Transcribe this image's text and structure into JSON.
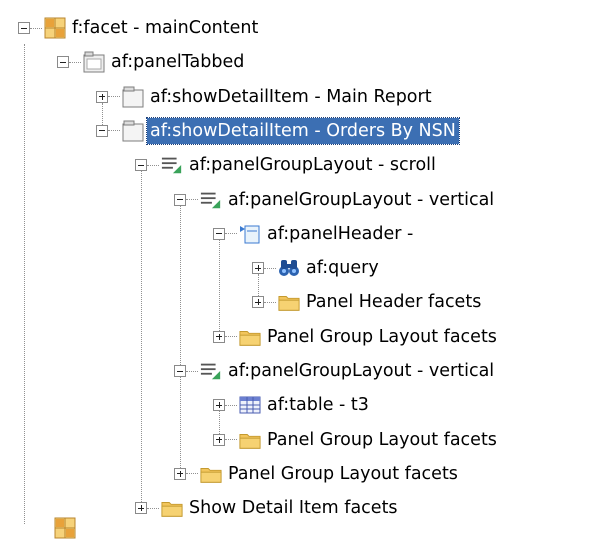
{
  "tree": {
    "nodes": [
      {
        "label": "f:facet - mainContent",
        "icon": "facet-icon",
        "depth": 0,
        "state": "expanded",
        "selected": false
      },
      {
        "label": "af:panelTabbed",
        "icon": "panel-tabbed-icon",
        "depth": 1,
        "state": "expanded",
        "selected": false
      },
      {
        "label": "af:showDetailItem - Main Report",
        "icon": "show-detail-item-icon",
        "depth": 2,
        "state": "collapsed",
        "selected": false
      },
      {
        "label": "af:showDetailItem - Orders By NSN",
        "icon": "show-detail-item-icon",
        "depth": 2,
        "state": "expanded",
        "selected": true
      },
      {
        "label": "af:panelGroupLayout - scroll",
        "icon": "panel-group-layout-icon",
        "depth": 3,
        "state": "expanded",
        "selected": false
      },
      {
        "label": "af:panelGroupLayout - vertical",
        "icon": "panel-group-layout-icon",
        "depth": 4,
        "state": "expanded",
        "selected": false
      },
      {
        "label": "af:panelHeader -",
        "icon": "panel-header-icon",
        "depth": 5,
        "state": "expanded",
        "selected": false
      },
      {
        "label": "af:query",
        "icon": "binoculars-icon",
        "depth": 6,
        "state": "collapsed",
        "selected": false
      },
      {
        "label": "Panel Header facets",
        "icon": "folder-icon",
        "depth": 6,
        "state": "collapsed",
        "selected": false
      },
      {
        "label": "Panel Group Layout facets",
        "icon": "folder-icon",
        "depth": 5,
        "state": "collapsed",
        "selected": false
      },
      {
        "label": "af:panelGroupLayout - vertical",
        "icon": "panel-group-layout-icon",
        "depth": 4,
        "state": "expanded",
        "selected": false
      },
      {
        "label": "af:table - t3",
        "icon": "table-icon",
        "depth": 5,
        "state": "collapsed",
        "selected": false
      },
      {
        "label": "Panel Group Layout facets",
        "icon": "folder-icon",
        "depth": 5,
        "state": "collapsed",
        "selected": false
      },
      {
        "label": "Panel Group Layout facets",
        "icon": "folder-icon",
        "depth": 4,
        "state": "collapsed",
        "selected": false
      },
      {
        "label": "Show Detail Item facets",
        "icon": "folder-icon",
        "depth": 3,
        "state": "collapsed",
        "selected": false
      }
    ]
  },
  "colors": {
    "selection": "#3c6fb3",
    "folder": "#f2c55c",
    "facet": "#e8a23a"
  }
}
